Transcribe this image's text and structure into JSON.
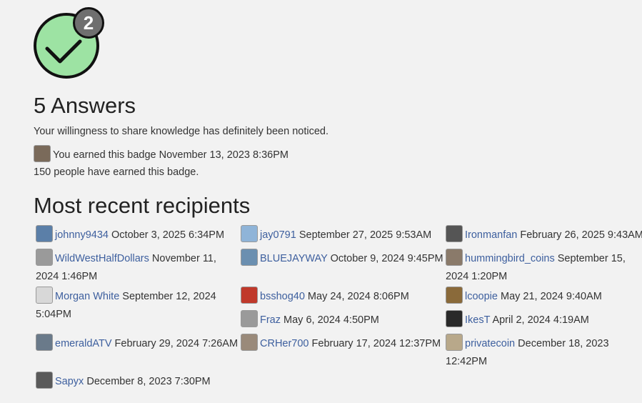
{
  "badge": {
    "count": "2",
    "colors": {
      "fill": "#9de3a3",
      "outline": "#111111",
      "count_bg": "#6f6f6f"
    }
  },
  "title": "5 Answers",
  "description": "Your willingness to share knowledge has definitely been noticed.",
  "earned_text": "You earned this badge November 13, 2023 8:36PM",
  "earned_count_text": "150 people have earned this badge.",
  "recipients_heading": "Most recent recipients",
  "recipients": [
    {
      "name": "johnny9434",
      "date": "October 3, 2025 6:34PM",
      "avatar_color": "#5b7fa8"
    },
    {
      "name": "jay0791",
      "date": "September 27, 2025 9:53AM",
      "avatar_color": "#8fb4d8"
    },
    {
      "name": "Ironmanfan",
      "date": "February 26, 2025 9:43AM",
      "avatar_color": "#555555"
    },
    {
      "name": "WildWestHalfDollars",
      "date": "November 11, 2024 1:46PM",
      "avatar_color": "#9a9a9a"
    },
    {
      "name": "BLUEJAYWAY",
      "date": "October 9, 2024 9:45PM",
      "avatar_color": "#6b8fb0"
    },
    {
      "name": "hummingbird_coins",
      "date": "September 15, 2024 1:20PM",
      "avatar_color": "#8a7a6a"
    },
    {
      "name": "Morgan White",
      "date": "September 12, 2024 5:04PM",
      "avatar_color": "#d8d8d8"
    },
    {
      "name": "bsshog40",
      "date": "May 24, 2024 8:06PM",
      "avatar_color": "#c0392b"
    },
    {
      "name": "lcoopie",
      "date": "May 21, 2024 9:40AM",
      "avatar_color": "#8a6a3a"
    },
    {
      "name": "Fraz",
      "date": "May 6, 2024 4:50PM",
      "avatar_color": "#9a9a9a"
    },
    {
      "name": "IkesT",
      "date": "April 2, 2024 4:19AM",
      "avatar_color": "#2a2a2a"
    },
    {
      "name": "emeraldATV",
      "date": "February 29, 2024 7:26AM",
      "avatar_color": "#6a7a8a"
    },
    {
      "name": "CRHer700",
      "date": "February 17, 2024 12:37PM",
      "avatar_color": "#9a8a7a"
    },
    {
      "name": "privatecoin",
      "date": "December 18, 2023 12:42PM",
      "avatar_color": "#b8a88a"
    },
    {
      "name": "Sapyx",
      "date": "December 8, 2023 7:30PM",
      "avatar_color": "#5a5a5a"
    }
  ]
}
